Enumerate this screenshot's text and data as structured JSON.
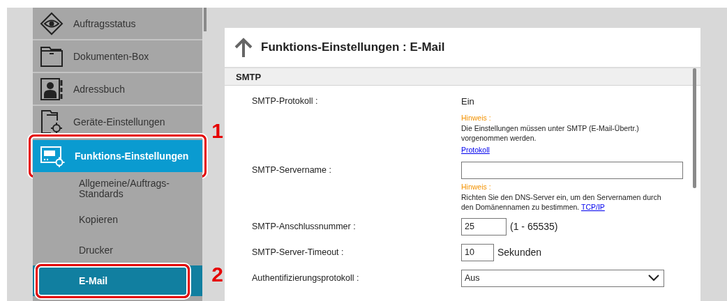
{
  "sidebar": {
    "items": [
      {
        "kind": "main",
        "label": "Auftragsstatus",
        "selected": false
      },
      {
        "kind": "main",
        "label": "Dokumenten-Box",
        "selected": false
      },
      {
        "kind": "main",
        "label": "Adressbuch",
        "selected": false
      },
      {
        "kind": "main",
        "label": "Geräte-Einstellungen",
        "selected": false
      },
      {
        "kind": "main",
        "label": "Funktions-Einstellungen",
        "selected": true,
        "callout": "1"
      },
      {
        "kind": "sub",
        "label": "Allgemeine/Auftrags-Standards",
        "selected": false
      },
      {
        "kind": "sub",
        "label": "Kopieren",
        "selected": false
      },
      {
        "kind": "sub",
        "label": "Drucker",
        "selected": false
      },
      {
        "kind": "sub",
        "label": "E-Mail",
        "selected": true,
        "callout": "2"
      }
    ]
  },
  "main": {
    "title": "Funktions-Einstellungen : E-Mail",
    "section": "SMTP",
    "rows": [
      {
        "kind": "text",
        "label": "SMTP-Protokoll :",
        "value": "Ein",
        "note": {
          "title": "Hinweis :",
          "text": "Die Einstellungen müssen unter SMTP (E-Mail-Übertr.) vorgenommen werden.",
          "link": "Protokoll"
        }
      },
      {
        "kind": "input",
        "label": "SMTP-Servername :",
        "value": "",
        "note": {
          "title": "Hinweis :",
          "text": "Richten Sie den DNS-Server ein, um den Servernamen durch den Domänennamen zu bestimmen.",
          "link": "TCP/IP"
        }
      },
      {
        "kind": "number",
        "label": "SMTP-Anschlussnummer :",
        "value": "25",
        "suffix": "(1 - 65535)"
      },
      {
        "kind": "short",
        "label": "SMTP-Server-Timeout :",
        "value": "10",
        "suffix": "Sekunden"
      },
      {
        "kind": "select",
        "label": "Authentifizierungsprotokoll :",
        "value": "Aus"
      }
    ]
  }
}
